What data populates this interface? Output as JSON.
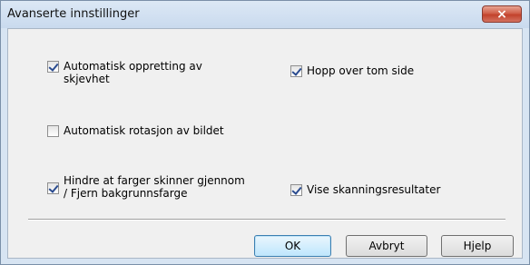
{
  "window": {
    "title": "Avanserte innstillinger",
    "close_glyph": "×"
  },
  "options": {
    "deskew": {
      "label": "Automatisk oppretting av\nskjevhet",
      "checked": true
    },
    "skip_blank": {
      "label": "Hopp over tom side",
      "checked": true
    },
    "auto_rotate": {
      "label": "Automatisk rotasjon av bildet",
      "checked": false
    },
    "bleed_through": {
      "label": "Hindre at farger skinner gjennom\n/ Fjern bakgrunnsfarge",
      "checked": true
    },
    "show_results": {
      "label": "Vise skanningsresultater",
      "checked": true
    }
  },
  "buttons": {
    "ok": "OK",
    "cancel": "Avbryt",
    "help": "Hjelp"
  },
  "colors": {
    "frame": "#d7e4f2",
    "close_button": "#c2422c",
    "default_button": "#bee6fd"
  }
}
